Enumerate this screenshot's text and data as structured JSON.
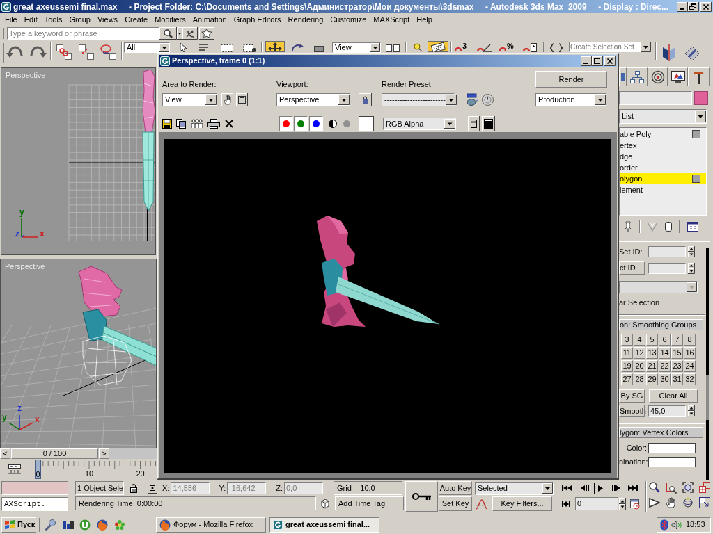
{
  "window": {
    "title": "great axeussemi final.max     - Project Folder: C:\\Documents and Settings\\Администратор\\Мои документы\\3dsmax     - Autodesk 3ds Max  2009     - Display : Direc..."
  },
  "menu": [
    "File",
    "Edit",
    "Tools",
    "Group",
    "Views",
    "Create",
    "Modifiers",
    "Animation",
    "Graph Editors",
    "Rendering",
    "Customize",
    "MAXScript",
    "Help"
  ],
  "search": {
    "placeholder": "Type a keyword or phrase"
  },
  "main_toolbar": {
    "selection_filter": "All",
    "reference_coordinate_system": "View",
    "snaps_toggle": "3",
    "percent_snap": "%",
    "named_selection_set": {
      "placeholder": "Create Selection Set"
    },
    "buttons": [
      {
        "on": false
      },
      {
        "on": true
      },
      {
        "on": false
      },
      {
        "on": false
      },
      {
        "on": false
      },
      {
        "on": true
      },
      {
        "on": false
      },
      {
        "on": false
      }
    ]
  },
  "viewports": [
    {
      "label": "Perspective",
      "axes": [
        {
          "label": "y",
          "color": "#007000"
        },
        {
          "label": "z",
          "color": "#2030d0"
        },
        {
          "label": "x",
          "color": "#d02020"
        }
      ]
    },
    {
      "label": "Perspective",
      "axes": [
        {
          "label": "z",
          "color": "#2030d0"
        },
        {
          "label": "y",
          "color": "#007000"
        },
        {
          "label": "x",
          "color": "#d02020"
        }
      ]
    }
  ],
  "time_slider": {
    "previous": "<",
    "frame": "0 / 100",
    "next": ">",
    "level": 0
  },
  "track_bar": {
    "current_frame": "0",
    "ticks": [
      "10",
      "20"
    ]
  },
  "render_window": {
    "title": "Perspective, frame 0 (1:1)",
    "area_to_render": {
      "label": "Area to Render:",
      "value": "View"
    },
    "viewport": {
      "label": "Viewport:",
      "value": "Perspective"
    },
    "render_preset": {
      "label": "Render Preset:",
      "value": "------------------------"
    },
    "render_button": "Render",
    "render_mode": "Production",
    "channels": [
      {
        "color": "#ff0000",
        "on": true
      },
      {
        "color": "#008000",
        "on": true
      },
      {
        "color": "#0000ff",
        "on": true
      }
    ],
    "display_channel": "RGB Alpha"
  },
  "command_panel": {
    "modifier_list": "List",
    "stack": [
      {
        "label": "able Poly",
        "selected": false,
        "children": [
          {
            "label": "ertex",
            "selected": false
          },
          {
            "label": "dge",
            "selected": false
          },
          {
            "label": "order",
            "selected": false
          },
          {
            "label": "olygon",
            "selected": true
          },
          {
            "label": "lement",
            "selected": false
          }
        ]
      }
    ],
    "material_ids": {
      "set_id": "Set ID:",
      "select_id": "ct ID",
      "clear_selection": "ar Selection"
    },
    "smoothing_groups": {
      "title": "on: Smoothing Groups",
      "groups": [
        "3",
        "4",
        "5",
        "6",
        "7",
        "8",
        "11",
        "12",
        "13",
        "14",
        "15",
        "16",
        "19",
        "20",
        "21",
        "22",
        "23",
        "24",
        "27",
        "28",
        "29",
        "30",
        "31",
        "32"
      ],
      "select_by_sg": "By SG",
      "clear_all": "Clear All",
      "auto_smooth": "Smooth",
      "threshold": "45,0"
    },
    "vertex_colors": {
      "title": "lygon: Vertex Colors",
      "fields": [
        {
          "label": "Color:"
        },
        {
          "label": "nination:"
        }
      ]
    }
  },
  "status_bar": {
    "script_input": "AXScript.",
    "selection": "1 Object Sele",
    "coordinates": [
      {
        "label": "X:",
        "value": "14,536"
      },
      {
        "label": "Y:",
        "value": "-16,642"
      },
      {
        "label": "Z:",
        "value": "0,0"
      }
    ],
    "grid": "Grid = 10,0",
    "prompt": "Rendering Time  0:00:00",
    "time_tag": "Add Time Tag"
  },
  "animation_controls": {
    "auto_key": "Auto Key",
    "set_key": "Set Key",
    "key_set": "Selected",
    "key_filters": "Key Filters...",
    "current_frame": "0"
  },
  "taskbar": {
    "start": "Пуск",
    "tasks": [
      {
        "label": "Форум - Mozilla Firefox",
        "selected": false
      },
      {
        "label": "great axeussemi final...",
        "selected": true
      }
    ],
    "clock": "18:53"
  }
}
